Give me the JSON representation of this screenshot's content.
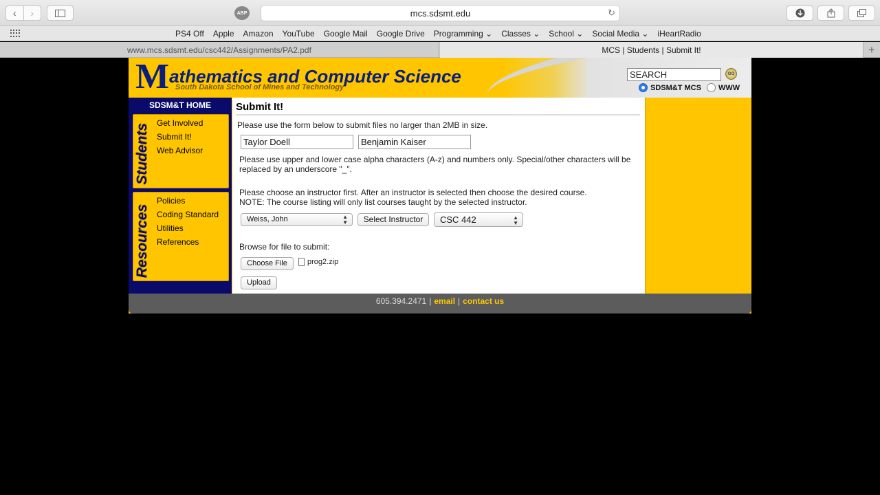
{
  "browser": {
    "url": "mcs.sdsmt.edu",
    "abp_label": "ABP",
    "bookmarks": [
      "PS4 Off",
      "Apple",
      "Amazon",
      "YouTube",
      "Google Mail",
      "Google Drive",
      "Programming ⌄",
      "Classes ⌄",
      "School ⌄",
      "Social Media ⌄",
      "iHeartRadio"
    ],
    "tabs": [
      {
        "label": "www.mcs.sdsmt.edu/csc442/Assignments/PA2.pdf",
        "active": false
      },
      {
        "label": "MCS | Students | Submit It!",
        "active": true
      }
    ]
  },
  "header": {
    "logo_m": "M",
    "logo_rest": "athematics and Computer Science",
    "subtitle": "South Dakota School of Mines and Technology",
    "search_value": "SEARCH",
    "go_label": "GO",
    "radio_options": [
      "SDSM&T MCS",
      "WWW"
    ],
    "selected_radio": "SDSM&T MCS"
  },
  "sidebar": {
    "home": "SDSM&T HOME",
    "students_label": "Students",
    "students_links": [
      "Get Involved",
      "Submit It!",
      "Web Advisor"
    ],
    "resources_label": "Resources",
    "resources_links": [
      "Policies",
      "Coding Standard",
      "Utilities",
      "References"
    ]
  },
  "content": {
    "title": "Submit It!",
    "intro": "Please use the form below to submit files no larger than 2MB in size.",
    "name1": "Taylor Doell",
    "name2": "Benjamin Kaiser",
    "name_note": "Please use upper and lower case alpha characters (A-z) and numbers only. Special/other characters will be replaced by an underscore \"_\".",
    "instructor_note_1": "Please choose an instructor first. After an instructor is selected then choose the desired course.",
    "instructor_note_2": "NOTE: The course listing will only list courses taught by the selected instructor.",
    "instructor_value": "Weiss, John",
    "select_instructor_label": "Select Instructor",
    "course_value": "CSC 442",
    "browse_label": "Browse for file to submit:",
    "choose_file_label": "Choose File",
    "file_name": "prog2.zip",
    "upload_label": "Upload"
  },
  "footer": {
    "phone": "605.394.2471",
    "sep": "|",
    "email": "email",
    "contact": "contact us"
  }
}
